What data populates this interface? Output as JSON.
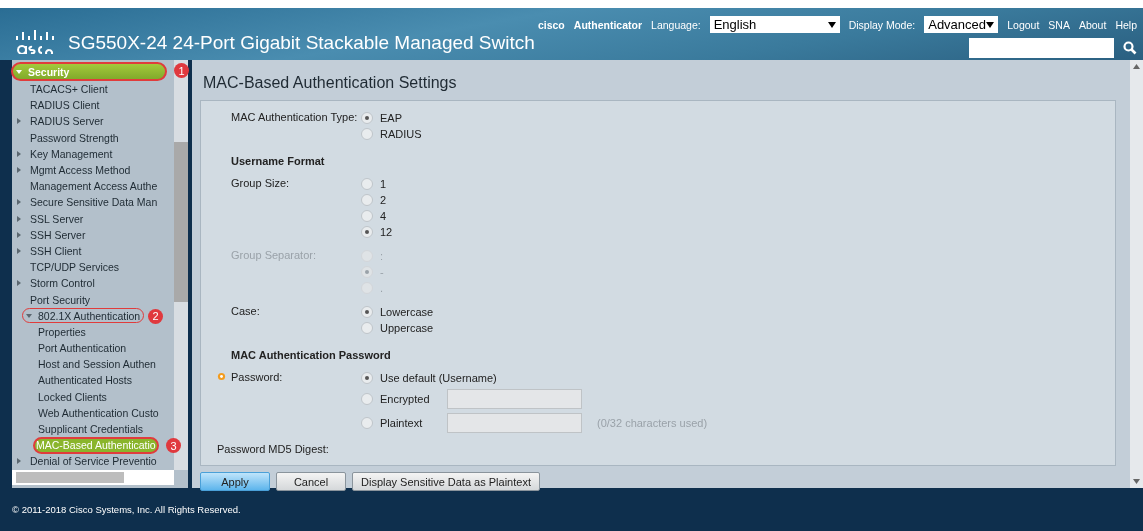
{
  "header": {
    "product": "SG550X-24 24-Port Gigabit Stackable Managed Switch",
    "user": "cisco",
    "role": "Authenticator",
    "language_label": "Language:",
    "language": "English",
    "display_mode_label": "Display Mode:",
    "display_mode": "Advanced",
    "links": [
      "Logout",
      "SNA",
      "About",
      "Help"
    ]
  },
  "sidebar": {
    "items": [
      {
        "label": "Security",
        "expandable": true,
        "expanded": true,
        "selected": false,
        "callout": "1",
        "children": [
          {
            "label": "TACACS+ Client",
            "expandable": false,
            "selected": false
          },
          {
            "label": "RADIUS Client",
            "expandable": false,
            "selected": false
          },
          {
            "label": "RADIUS Server",
            "expandable": true,
            "expanded": false,
            "selected": false
          },
          {
            "label": "Password Strength",
            "expandable": false,
            "selected": false
          },
          {
            "label": "Key Management",
            "expandable": true,
            "expanded": false,
            "selected": false
          },
          {
            "label": "Mgmt Access Method",
            "expandable": true,
            "expanded": false,
            "selected": false
          },
          {
            "label": "Management Access Authe",
            "expandable": false,
            "selected": false
          },
          {
            "label": "Secure Sensitive Data Man",
            "expandable": true,
            "expanded": false,
            "selected": false
          },
          {
            "label": "SSL Server",
            "expandable": true,
            "expanded": false,
            "selected": false
          },
          {
            "label": "SSH Server",
            "expandable": true,
            "expanded": false,
            "selected": false
          },
          {
            "label": "SSH Client",
            "expandable": true,
            "expanded": false,
            "selected": false
          },
          {
            "label": "TCP/UDP Services",
            "expandable": false,
            "selected": false
          },
          {
            "label": "Storm Control",
            "expandable": true,
            "expanded": false,
            "selected": false
          },
          {
            "label": "Port Security",
            "expandable": false,
            "selected": false
          },
          {
            "label": "802.1X Authentication",
            "expandable": true,
            "expanded": true,
            "selected": false,
            "callout": "2",
            "children": [
              {
                "label": "Properties",
                "expandable": false,
                "selected": false
              },
              {
                "label": "Port Authentication",
                "expandable": false,
                "selected": false
              },
              {
                "label": "Host and Session Authen",
                "expandable": false,
                "selected": false
              },
              {
                "label": "Authenticated Hosts",
                "expandable": false,
                "selected": false
              },
              {
                "label": "Locked Clients",
                "expandable": false,
                "selected": false
              },
              {
                "label": "Web Authentication Custo",
                "expandable": false,
                "selected": false
              },
              {
                "label": "Supplicant Credentials",
                "expandable": false,
                "selected": false
              },
              {
                "label": "MAC-Based Authenticatio",
                "expandable": false,
                "selected": true,
                "callout": "3"
              }
            ]
          },
          {
            "label": "Denial of Service Preventio",
            "expandable": true,
            "expanded": false,
            "selected": false
          }
        ]
      }
    ]
  },
  "page_title": "MAC-Based Authentication Settings",
  "form": [
    {
      "kind": "radio",
      "label": "MAC Authentication Type:",
      "disabled": false,
      "options": [
        {
          "label": "EAP",
          "selected": true
        },
        {
          "label": "RADIUS",
          "selected": false
        }
      ]
    },
    {
      "kind": "heading",
      "label": "Username Format"
    },
    {
      "kind": "radio",
      "label": "Group Size:",
      "disabled": false,
      "options": [
        {
          "label": "1",
          "selected": false
        },
        {
          "label": "2",
          "selected": false
        },
        {
          "label": "4",
          "selected": false
        },
        {
          "label": "12",
          "selected": true
        }
      ]
    },
    {
      "kind": "radio",
      "label": "Group Separator:",
      "disabled": true,
      "options": [
        {
          "label": ":",
          "selected": false
        },
        {
          "label": "-",
          "selected": true
        },
        {
          "label": ".",
          "selected": false
        }
      ]
    },
    {
      "kind": "radio",
      "label": "Case:",
      "disabled": false,
      "options": [
        {
          "label": "Lowercase",
          "selected": true
        },
        {
          "label": "Uppercase",
          "selected": false
        }
      ]
    },
    {
      "kind": "heading",
      "label": "MAC Authentication Password"
    },
    {
      "kind": "radio",
      "label": "Password:",
      "required": true,
      "disabled": false,
      "options": [
        {
          "label": "Use default (Username)",
          "selected": true
        },
        {
          "label": "Encrypted",
          "selected": false,
          "field": true
        },
        {
          "label": "Plaintext",
          "selected": false,
          "field": true,
          "note": "(0/32 characters used)"
        }
      ]
    },
    {
      "kind": "text",
      "label": "Password MD5 Digest:"
    }
  ],
  "buttons": [
    {
      "label": "Apply",
      "primary": true
    },
    {
      "label": "Cancel",
      "primary": false
    },
    {
      "label": "Display Sensitive Data as Plaintext",
      "primary": false
    }
  ],
  "footer": "© 2011-2018 Cisco Systems, Inc. All Rights Reserved."
}
